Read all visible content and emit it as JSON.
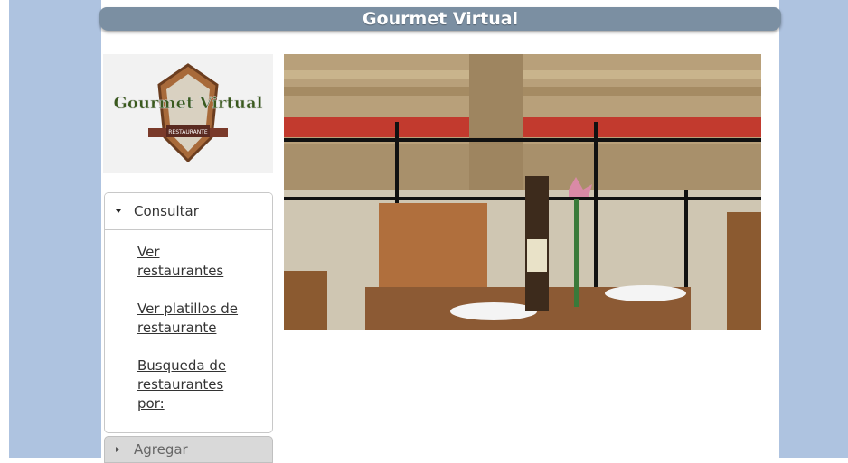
{
  "header": {
    "title": "Gourmet Virtual"
  },
  "logo": {
    "text": "Gourmet Virtual",
    "sub_text": "RESTAURANTE"
  },
  "menu": {
    "consultar": {
      "label": "Consultar",
      "links": [
        {
          "label": "Ver restaurantes"
        },
        {
          "label": "Ver platillos de restaurante"
        },
        {
          "label": "Busqueda de restaurantes por:"
        }
      ]
    },
    "agregar": {
      "label": "Agregar"
    }
  },
  "icons": {
    "expanded": "triangle-down-icon",
    "collapsed": "triangle-right-icon"
  },
  "colors": {
    "header_bg": "#7b8fa2",
    "side_bg": "#aec3e0",
    "logo_gold": "#3a5a1e"
  }
}
